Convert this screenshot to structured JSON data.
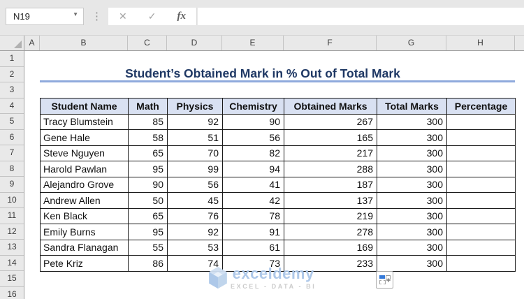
{
  "name_box": {
    "value": "N19"
  },
  "formula_bar": {
    "value": "",
    "cancel_glyph": "✕",
    "enter_glyph": "✓",
    "fx_label": "fx",
    "drag_handle_glyph": "⋮",
    "dropdown_glyph": "▼"
  },
  "column_headers": [
    "A",
    "B",
    "C",
    "D",
    "E",
    "F",
    "G",
    "H"
  ],
  "row_headers": [
    "1",
    "2",
    "3",
    "4",
    "5",
    "6",
    "7",
    "8",
    "9",
    "10",
    "11",
    "12",
    "13",
    "14",
    "15",
    "16"
  ],
  "title": {
    "text": "Student’s Obtained Mark in % Out of Total Mark"
  },
  "table": {
    "headers": [
      "Student Name",
      "Math",
      "Physics",
      "Chemistry",
      "Obtained Marks",
      "Total Marks",
      "Percentage"
    ],
    "rows": [
      [
        "Tracy Blumstein",
        "85",
        "92",
        "90",
        "267",
        "300",
        ""
      ],
      [
        "Gene Hale",
        "58",
        "51",
        "56",
        "165",
        "300",
        ""
      ],
      [
        "Steve Nguyen",
        "65",
        "70",
        "82",
        "217",
        "300",
        ""
      ],
      [
        "Harold Pawlan",
        "95",
        "99",
        "94",
        "288",
        "300",
        ""
      ],
      [
        "Alejandro Grove",
        "90",
        "56",
        "41",
        "187",
        "300",
        ""
      ],
      [
        "Andrew Allen",
        "50",
        "45",
        "42",
        "137",
        "300",
        ""
      ],
      [
        "Ken Black",
        "65",
        "76",
        "78",
        "219",
        "300",
        ""
      ],
      [
        "Emily Burns",
        "95",
        "92",
        "91",
        "278",
        "300",
        ""
      ],
      [
        "Sandra Flanagan",
        "55",
        "53",
        "61",
        "169",
        "300",
        ""
      ],
      [
        "Pete Kriz",
        "86",
        "74",
        "73",
        "233",
        "300",
        ""
      ]
    ]
  },
  "watermark": {
    "brand": "exceldemy",
    "tagline": "EXCEL - DATA - BI"
  },
  "quick_analysis": {
    "plus_glyph": "+"
  },
  "colors": {
    "title_text": "#1f3864",
    "title_underline": "#8faadc",
    "table_header_bg": "#d9e1f2",
    "table_border": "#1a1a1a",
    "accent_blue": "#3579d8"
  }
}
